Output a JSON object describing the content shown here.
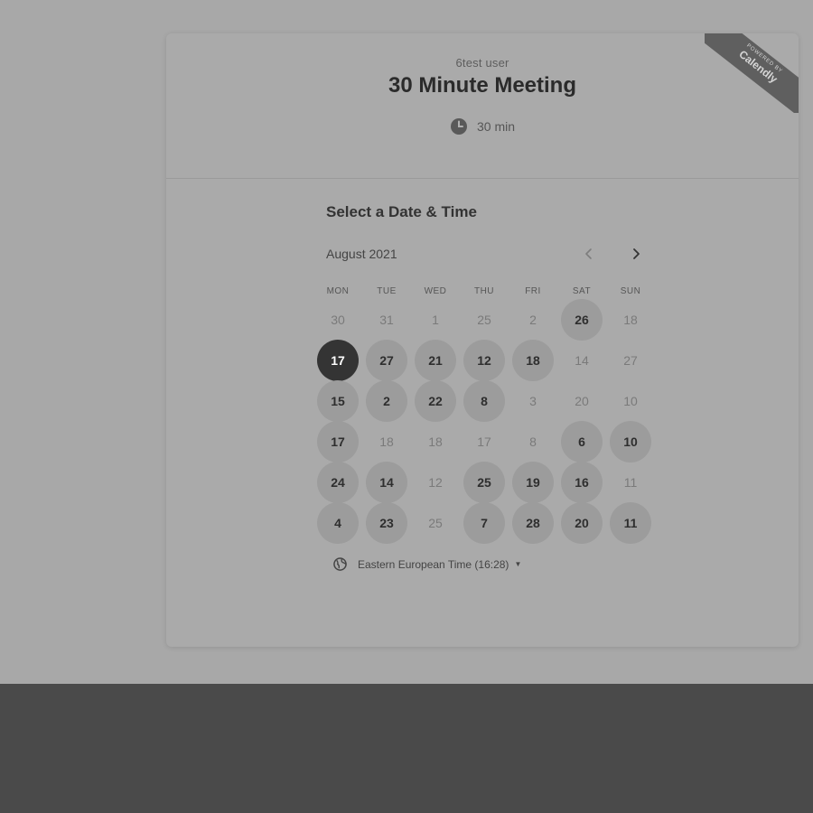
{
  "header": {
    "organizer": "6test user",
    "event_title": "30 Minute Meeting",
    "duration": "30 min",
    "duration_icon": "clock-icon"
  },
  "badge": {
    "line1": "POWERED BY",
    "line2": "Calendly"
  },
  "calendar": {
    "title": "Select a Date & Time",
    "month": "August 2021",
    "prev_icon": "chevron-left-icon",
    "next_icon": "chevron-right-icon",
    "weekdays": [
      "MON",
      "TUE",
      "WED",
      "THU",
      "FRI",
      "SAT",
      "SUN"
    ],
    "weeks": [
      [
        {
          "label": "30",
          "state": "unavailable"
        },
        {
          "label": "31",
          "state": "unavailable"
        },
        {
          "label": "1",
          "state": "unavailable"
        },
        {
          "label": "25",
          "state": "unavailable"
        },
        {
          "label": "2",
          "state": "unavailable"
        },
        {
          "label": "26",
          "state": "available"
        },
        {
          "label": "18",
          "state": "unavailable"
        }
      ],
      [
        {
          "label": "17",
          "state": "selected"
        },
        {
          "label": "27",
          "state": "available"
        },
        {
          "label": "21",
          "state": "available"
        },
        {
          "label": "12",
          "state": "available"
        },
        {
          "label": "18",
          "state": "available"
        },
        {
          "label": "14",
          "state": "unavailable"
        },
        {
          "label": "27",
          "state": "unavailable"
        }
      ],
      [
        {
          "label": "15",
          "state": "available"
        },
        {
          "label": "2",
          "state": "available"
        },
        {
          "label": "22",
          "state": "available"
        },
        {
          "label": "8",
          "state": "available"
        },
        {
          "label": "3",
          "state": "unavailable"
        },
        {
          "label": "20",
          "state": "unavailable"
        },
        {
          "label": "10",
          "state": "unavailable"
        }
      ],
      [
        {
          "label": "17",
          "state": "available"
        },
        {
          "label": "18",
          "state": "unavailable"
        },
        {
          "label": "18",
          "state": "unavailable"
        },
        {
          "label": "17",
          "state": "unavailable"
        },
        {
          "label": "8",
          "state": "unavailable"
        },
        {
          "label": "6",
          "state": "available"
        },
        {
          "label": "10",
          "state": "available"
        }
      ],
      [
        {
          "label": "24",
          "state": "available"
        },
        {
          "label": "14",
          "state": "available"
        },
        {
          "label": "12",
          "state": "unavailable"
        },
        {
          "label": "25",
          "state": "available"
        },
        {
          "label": "19",
          "state": "available"
        },
        {
          "label": "16",
          "state": "available"
        },
        {
          "label": "11",
          "state": "unavailable"
        }
      ],
      [
        {
          "label": "4",
          "state": "available"
        },
        {
          "label": "23",
          "state": "available"
        },
        {
          "label": "25",
          "state": "unavailable"
        },
        {
          "label": "7",
          "state": "available"
        },
        {
          "label": "28",
          "state": "available"
        },
        {
          "label": "20",
          "state": "available"
        },
        {
          "label": "11",
          "state": "available"
        }
      ]
    ]
  },
  "timezone": {
    "icon": "globe-icon",
    "label": "Eastern European Time (16:28)",
    "caret_icon": "caret-down-icon"
  },
  "colors": {
    "page_background": "#a8a8a8",
    "footer_band": "#4a4a4a",
    "available_day": "#9c9c9c",
    "selected_day": "#343434"
  }
}
